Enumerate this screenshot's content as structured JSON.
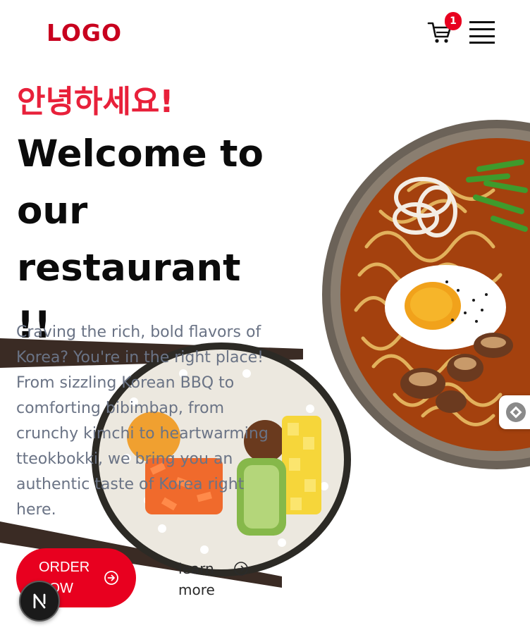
{
  "header": {
    "logo": "LOGO",
    "cart_count": "1",
    "icons": [
      "cart-icon",
      "hamburger-menu-icon"
    ]
  },
  "hero": {
    "greeting": "안녕하세요!",
    "title": "Welcome to our restaurant !!",
    "description": "Craving the rich, bold flavors of Korea? You're in the right place! From sizzling Korean BBQ to comforting bibimbap, from crunchy kimchi to heartwarming tteokbokki, we bring you an authentic taste of Korea right here.",
    "order_button": "ORDER NOW",
    "learn_more": "learn more",
    "images": [
      "ramen-bowl-image",
      "kimbap-roll-image"
    ]
  },
  "floaters": {
    "icons": [
      "side-widget-icon",
      "next-dev-badge-icon"
    ]
  },
  "colors": {
    "brand_red": "#e8001f",
    "logo_red": "#c8001e",
    "greeting_red": "#e8203a",
    "body_text": "#6a7385",
    "heading_text": "#0b0b0b"
  }
}
